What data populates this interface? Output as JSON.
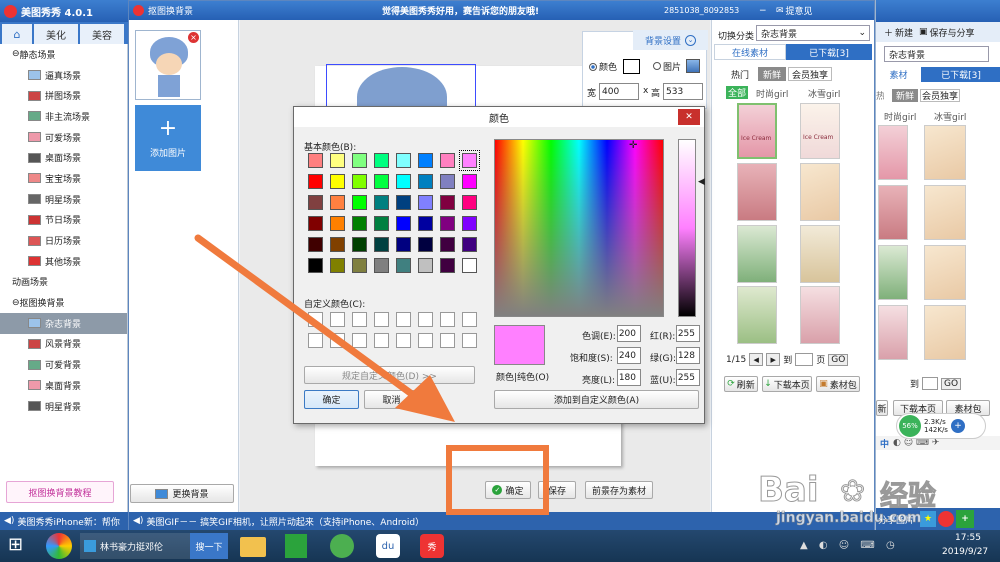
{
  "main_app": {
    "title": "美图秀秀 4.0.1",
    "tabs": [
      "美化",
      "美容"
    ],
    "ticker": "美图秀秀iPhone新：帮你"
  },
  "left_tree": {
    "groups": [
      {
        "label": "静态场景",
        "items": [
          "逼真场景",
          "拼图场景",
          "非主流场景",
          "可爱场景",
          "桌面场景",
          "宝宝场景",
          "明星场景",
          "节日场景",
          "日历场景",
          "其他场景"
        ]
      },
      {
        "label": "动画场景",
        "items": []
      },
      {
        "label": "抠图换背景",
        "items": [
          "杂志背景",
          "风景背景",
          "可爱背景",
          "桌面背景",
          "明星背景"
        ]
      }
    ],
    "tutorial": "抠图换背景教程"
  },
  "cutout": {
    "title": "抠图换背景",
    "slogan": "觉得美图秀秀好用，赛告诉您的朋友哦!",
    "account": "2851038_8092853",
    "feedback": "提意见",
    "add_image": "添加图片",
    "change_bg": "更换背景",
    "bg_settings": "背景设置",
    "bg_color": "颜色",
    "bg_image": "图片",
    "width_label": "宽",
    "width": "400",
    "height_label": "高",
    "height": "533",
    "confirm": "确定",
    "save": "保存",
    "save_material": "前景存为素材",
    "ticker": "美图GIF－－ 搞笑GIF相机，让照片动起来（支持iPhone、Android）"
  },
  "right_panel": {
    "switch_label": "切换分类",
    "category": "杂志背景",
    "tabs": [
      "在线素材",
      "已下载[3]"
    ],
    "filters": [
      "热门",
      "新鲜",
      "会员独享"
    ],
    "subfilters": [
      "全部",
      "时尚girl",
      "冰雪girl"
    ],
    "page": "1/15",
    "goto": "到",
    "page_unit": "页",
    "go": "GO",
    "refresh": "刷新",
    "download_page": "下载本页",
    "material_pack": "素材包",
    "thumb_texts": [
      "Ice Cream",
      "Ice Cream"
    ]
  },
  "back_panel": {
    "new": "新建",
    "save_share": "保存与分享",
    "category": "杂志背景",
    "tabs": [
      "素材",
      "已下载[3]"
    ],
    "filters": [
      "热门",
      "新鲜",
      "会员独享"
    ],
    "subfilters": [
      "全部",
      "时尚girl",
      "冰雪girl"
    ],
    "refresh": "新",
    "download": "下载本页",
    "pack": "素材包",
    "goto": "到",
    "go": "GO",
    "share": "分享图片",
    "ime": "中",
    "speed_pct": "56%",
    "up": "2.3K/s",
    "down": "142K/s"
  },
  "color_dialog": {
    "title": "颜色",
    "basic": "基本颜色(B):",
    "custom": "自定义颜色(C):",
    "define": "规定自定义颜色(D) >>",
    "ok": "确定",
    "cancel": "取消",
    "color_solid": "颜色|纯色(O)",
    "hue_label": "色调(E):",
    "hue": "200",
    "sat_label": "饱和度(S):",
    "sat": "240",
    "lum_label": "亮度(L):",
    "lum": "180",
    "red_label": "红(R):",
    "red": "255",
    "green_label": "绿(G):",
    "green": "128",
    "blue_label": "蓝(U):",
    "blue": "255",
    "add_custom": "添加到自定义颜色(A)",
    "selected_color": "#FF80FF"
  },
  "basic_colors": [
    "#ff8080",
    "#ffff80",
    "#80ff80",
    "#00ff80",
    "#80ffff",
    "#0080ff",
    "#ff80c0",
    "#ff80ff",
    "#ff0000",
    "#ffff00",
    "#80ff00",
    "#00ff40",
    "#00ffff",
    "#0080c0",
    "#8080c0",
    "#ff00ff",
    "#804040",
    "#ff8040",
    "#00ff00",
    "#008080",
    "#004080",
    "#8080ff",
    "#800040",
    "#ff0080",
    "#800000",
    "#ff8000",
    "#008000",
    "#008040",
    "#0000ff",
    "#0000a0",
    "#800080",
    "#8000ff",
    "#400000",
    "#804000",
    "#004000",
    "#004040",
    "#000080",
    "#000040",
    "#400040",
    "#400080",
    "#000000",
    "#808000",
    "#808040",
    "#808080",
    "#408080",
    "#c0c0c0",
    "#400040",
    "#ffffff"
  ],
  "taskbar": {
    "task_label": "林书豪力挺邓伦",
    "search": "搜一下",
    "time": "17:55",
    "date": "2019/9/27"
  },
  "watermark": {
    "brand": "Bai",
    "brand2": "经验",
    "url": "jingyan.baidu.com"
  },
  "colors": {
    "accent": "#2f6fc4",
    "selected": "#ff80ff",
    "arrow": "#f07a3d"
  }
}
